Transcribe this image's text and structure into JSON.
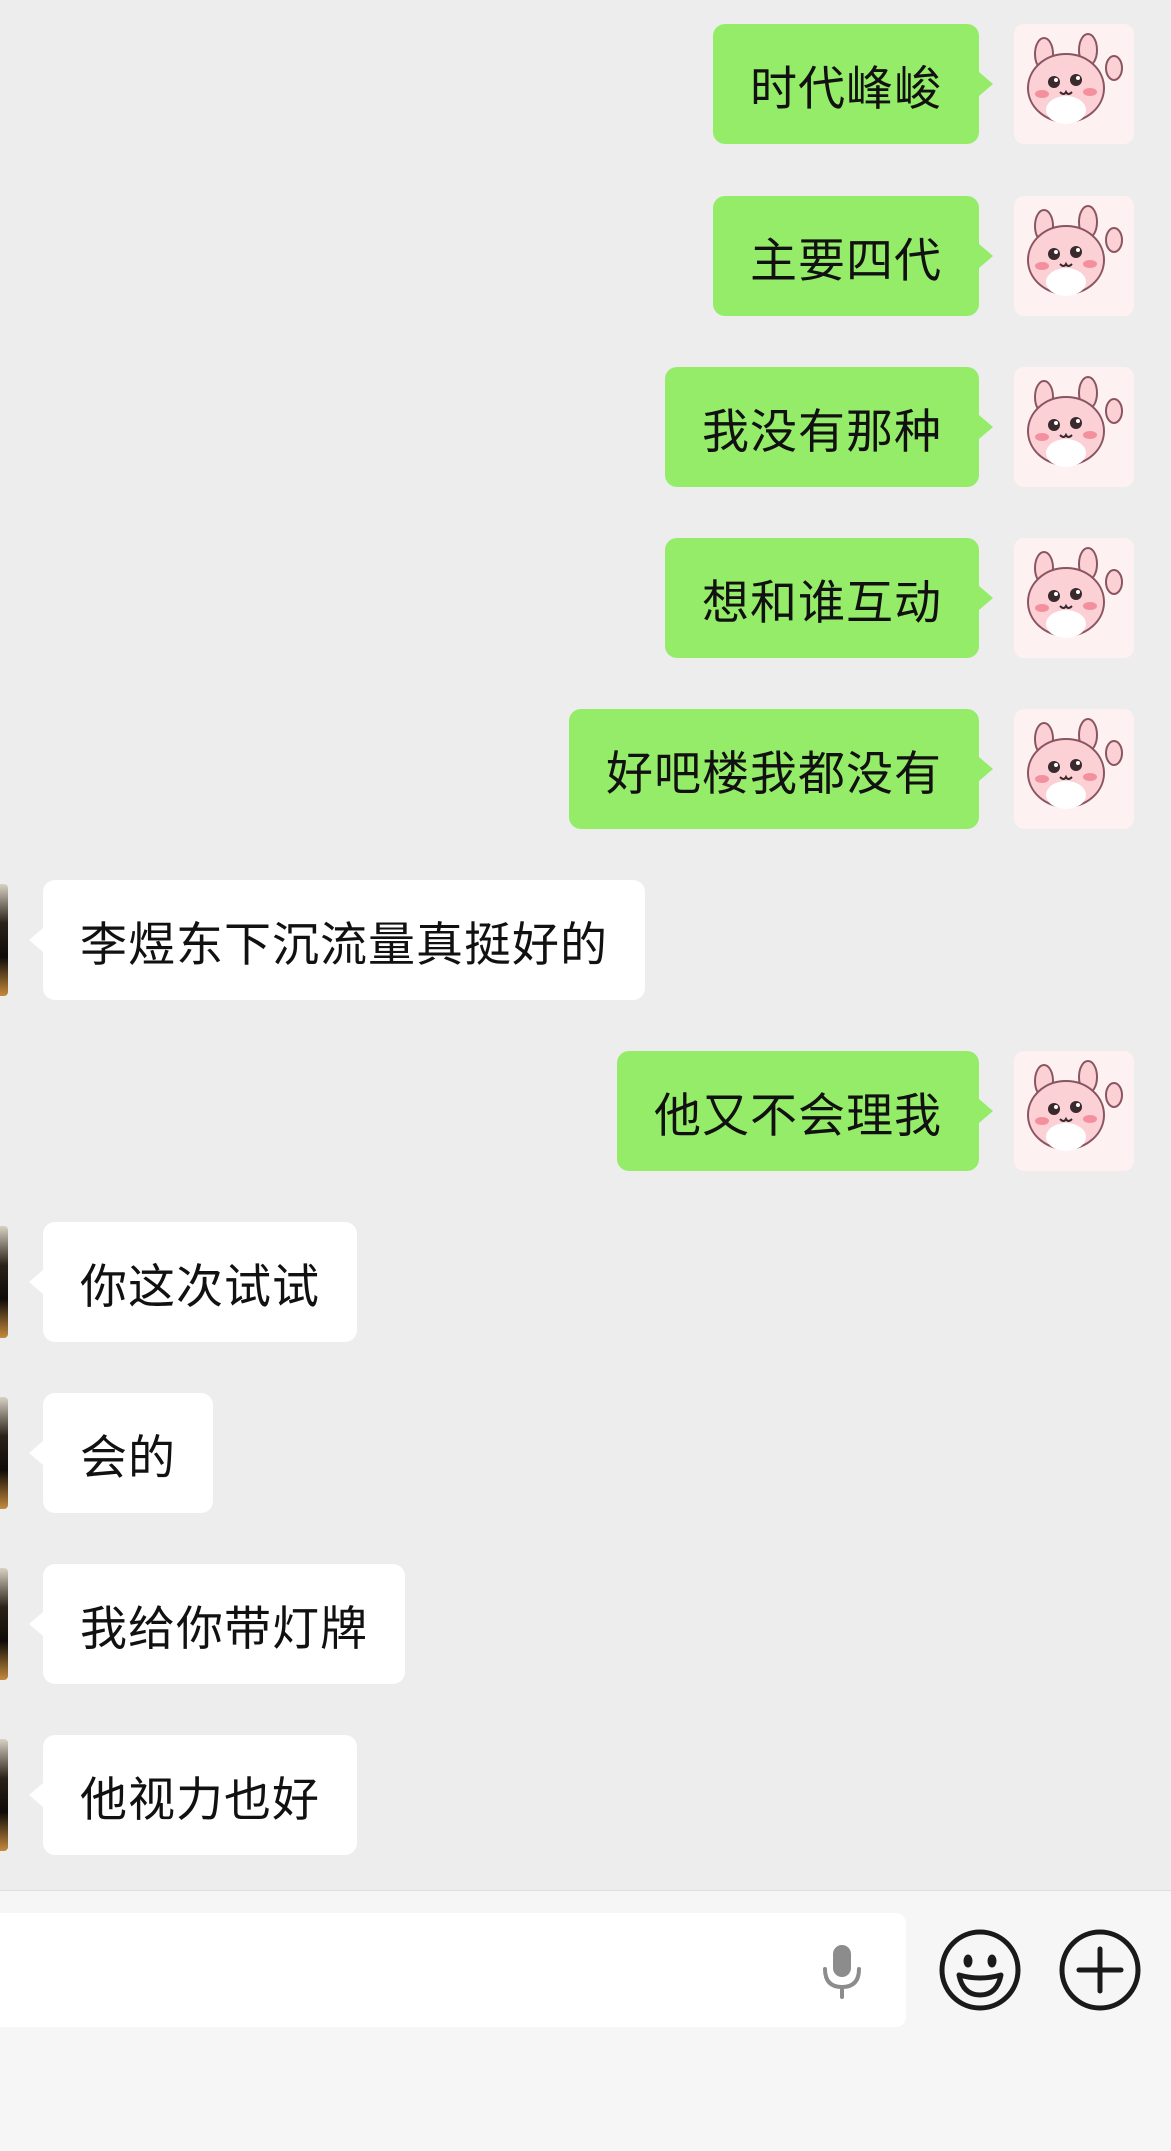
{
  "conversation": {
    "messages": [
      {
        "sender": "me",
        "text": "时代峰峻"
      },
      {
        "sender": "me",
        "text": "主要四代"
      },
      {
        "sender": "me",
        "text": "我没有那种"
      },
      {
        "sender": "me",
        "text": "想和谁互动"
      },
      {
        "sender": "me",
        "text": "好吧楼我都没有"
      },
      {
        "sender": "other",
        "text": "李煜东下沉流量真挺好的"
      },
      {
        "sender": "me",
        "text": "他又不会理我"
      },
      {
        "sender": "other",
        "text": "你这次试试"
      },
      {
        "sender": "other",
        "text": "会的"
      },
      {
        "sender": "other",
        "text": "我给你带灯牌"
      },
      {
        "sender": "other",
        "text": "他视力也好"
      }
    ]
  },
  "input_bar": {
    "text_value": "",
    "icons": [
      "microphone-icon",
      "emoji-icon",
      "plus-icon"
    ]
  },
  "colors": {
    "background": "#ededed",
    "outgoing_bubble": "#95ec69",
    "incoming_bubble": "#ffffff",
    "input_bar": "#f6f6f6"
  }
}
